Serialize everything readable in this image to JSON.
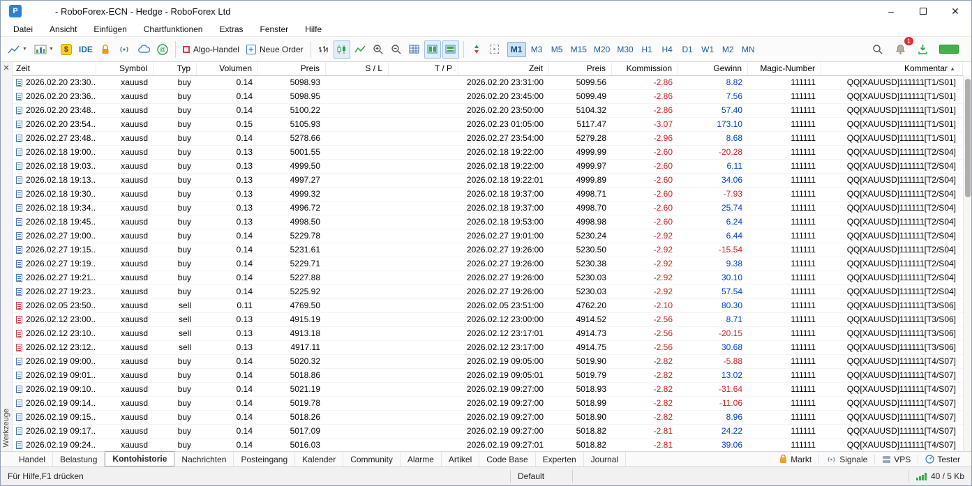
{
  "window": {
    "title": "- RoboForex-ECN - Hedge - RoboForex Ltd",
    "app_icon_text": "P"
  },
  "menu": {
    "items": [
      "Datei",
      "Ansicht",
      "Einfügen",
      "Chartfunktionen",
      "Extras",
      "Fenster",
      "Hilfe"
    ]
  },
  "toolbar": {
    "ide_label": "IDE",
    "algo_trading_label": "Algo-Handel",
    "new_order_label": "Neue Order",
    "dollar_symbol": "$",
    "plus_symbol": "+",
    "timeframes": [
      "M1",
      "M3",
      "M5",
      "M15",
      "M20",
      "M30",
      "H1",
      "H4",
      "D1",
      "W1",
      "M2",
      "MN"
    ],
    "active_timeframe": "M1",
    "notification_badge": "1"
  },
  "toolbox": {
    "vertical_label": "Werkzeuge",
    "close_glyph": "✕"
  },
  "history_table": {
    "headers": [
      "Zeit",
      "Symbol",
      "Typ",
      "Volumen",
      "Preis",
      "S / L",
      "T / P",
      "Zeit",
      "Preis",
      "Kommission",
      "Gewinn",
      "Magic-Number",
      "Kommentar"
    ],
    "sorted_by": "Kommentar",
    "sort_direction": "ascending",
    "rows": [
      [
        "2026.02.20 23:30...",
        "xauusd",
        "buy",
        "0.14",
        "5098.93",
        "",
        "",
        "2026.02.20 23:31:00",
        "5099.56",
        "-2.86",
        "8.82",
        "111111",
        "QQ[XAUUSD]111111[T1/S01]"
      ],
      [
        "2026.02.20 23:36...",
        "xauusd",
        "buy",
        "0.14",
        "5098.95",
        "",
        "",
        "2026.02.20 23:45:00",
        "5099.49",
        "-2.86",
        "7.56",
        "111111",
        "QQ[XAUUSD]111111[T1/S01]"
      ],
      [
        "2026.02.20 23:48...",
        "xauusd",
        "buy",
        "0.14",
        "5100.22",
        "",
        "",
        "2026.02.20 23:50:00",
        "5104.32",
        "-2.86",
        "57.40",
        "111111",
        "QQ[XAUUSD]111111[T1/S01]"
      ],
      [
        "2026.02.20 23:54...",
        "xauusd",
        "buy",
        "0.15",
        "5105.93",
        "",
        "",
        "2026.02.23 01:05:00",
        "5117.47",
        "-3.07",
        "173.10",
        "111111",
        "QQ[XAUUSD]111111[T1/S01]"
      ],
      [
        "2026.02.27 23:48...",
        "xauusd",
        "buy",
        "0.14",
        "5278.66",
        "",
        "",
        "2026.02.27 23:54:00",
        "5279.28",
        "-2.96",
        "8.68",
        "111111",
        "QQ[XAUUSD]111111[T1/S01]"
      ],
      [
        "2026.02.18 19:00...",
        "xauusd",
        "buy",
        "0.13",
        "5001.55",
        "",
        "",
        "2026.02.18 19:22:00",
        "4999.99",
        "-2.60",
        "-20.28",
        "111111",
        "QQ[XAUUSD]111111[T2/S04]"
      ],
      [
        "2026.02.18 19:03...",
        "xauusd",
        "buy",
        "0.13",
        "4999.50",
        "",
        "",
        "2026.02.18 19:22:00",
        "4999.97",
        "-2.60",
        "6.11",
        "111111",
        "QQ[XAUUSD]111111[T2/S04]"
      ],
      [
        "2026.02.18 19:13...",
        "xauusd",
        "buy",
        "0.13",
        "4997.27",
        "",
        "",
        "2026.02.18 19:22:01",
        "4999.89",
        "-2.60",
        "34.06",
        "111111",
        "QQ[XAUUSD]111111[T2/S04]"
      ],
      [
        "2026.02.18 19:30...",
        "xauusd",
        "buy",
        "0.13",
        "4999.32",
        "",
        "",
        "2026.02.18 19:37:00",
        "4998.71",
        "-2.60",
        "-7.93",
        "111111",
        "QQ[XAUUSD]111111[T2/S04]"
      ],
      [
        "2026.02.18 19:34...",
        "xauusd",
        "buy",
        "0.13",
        "4996.72",
        "",
        "",
        "2026.02.18 19:37:00",
        "4998.70",
        "-2.60",
        "25.74",
        "111111",
        "QQ[XAUUSD]111111[T2/S04]"
      ],
      [
        "2026.02.18 19:45...",
        "xauusd",
        "buy",
        "0.13",
        "4998.50",
        "",
        "",
        "2026.02.18 19:53:00",
        "4998.98",
        "-2.60",
        "6.24",
        "111111",
        "QQ[XAUUSD]111111[T2/S04]"
      ],
      [
        "2026.02.27 19:00...",
        "xauusd",
        "buy",
        "0.14",
        "5229.78",
        "",
        "",
        "2026.02.27 19:01:00",
        "5230.24",
        "-2.92",
        "6.44",
        "111111",
        "QQ[XAUUSD]111111[T2/S04]"
      ],
      [
        "2026.02.27 19:15...",
        "xauusd",
        "buy",
        "0.14",
        "5231.61",
        "",
        "",
        "2026.02.27 19:26:00",
        "5230.50",
        "-2.92",
        "-15.54",
        "111111",
        "QQ[XAUUSD]111111[T2/S04]"
      ],
      [
        "2026.02.27 19:19...",
        "xauusd",
        "buy",
        "0.14",
        "5229.71",
        "",
        "",
        "2026.02.27 19:26:00",
        "5230.38",
        "-2.92",
        "9.38",
        "111111",
        "QQ[XAUUSD]111111[T2/S04]"
      ],
      [
        "2026.02.27 19:21...",
        "xauusd",
        "buy",
        "0.14",
        "5227.88",
        "",
        "",
        "2026.02.27 19:26:00",
        "5230.03",
        "-2.92",
        "30.10",
        "111111",
        "QQ[XAUUSD]111111[T2/S04]"
      ],
      [
        "2026.02.27 19:23...",
        "xauusd",
        "buy",
        "0.14",
        "5225.92",
        "",
        "",
        "2026.02.27 19:26:00",
        "5230.03",
        "-2.92",
        "57.54",
        "111111",
        "QQ[XAUUSD]111111[T2/S04]"
      ],
      [
        "2026.02.05 23:50...",
        "xauusd",
        "sell",
        "0.11",
        "4769.50",
        "",
        "",
        "2026.02.05 23:51:00",
        "4762.20",
        "-2.10",
        "80.30",
        "111111",
        "QQ[XAUUSD]111111[T3/S06]"
      ],
      [
        "2026.02.12 23:00...",
        "xauusd",
        "sell",
        "0.13",
        "4915.19",
        "",
        "",
        "2026.02.12 23:00:00",
        "4914.52",
        "-2.56",
        "8.71",
        "111111",
        "QQ[XAUUSD]111111[T3/S06]"
      ],
      [
        "2026.02.12 23:10...",
        "xauusd",
        "sell",
        "0.13",
        "4913.18",
        "",
        "",
        "2026.02.12 23:17:01",
        "4914.73",
        "-2.56",
        "-20.15",
        "111111",
        "QQ[XAUUSD]111111[T3/S06]"
      ],
      [
        "2026.02.12 23:12...",
        "xauusd",
        "sell",
        "0.13",
        "4917.11",
        "",
        "",
        "2026.02.12 23:17:00",
        "4914.75",
        "-2.56",
        "30.68",
        "111111",
        "QQ[XAUUSD]111111[T3/S06]"
      ],
      [
        "2026.02.19 09:00...",
        "xauusd",
        "buy",
        "0.14",
        "5020.32",
        "",
        "",
        "2026.02.19 09:05:00",
        "5019.90",
        "-2.82",
        "-5.88",
        "111111",
        "QQ[XAUUSD]111111[T4/S07]"
      ],
      [
        "2026.02.19 09:01...",
        "xauusd",
        "buy",
        "0.14",
        "5018.86",
        "",
        "",
        "2026.02.19 09:05:01",
        "5019.79",
        "-2.82",
        "13.02",
        "111111",
        "QQ[XAUUSD]111111[T4/S07]"
      ],
      [
        "2026.02.19 09:10...",
        "xauusd",
        "buy",
        "0.14",
        "5021.19",
        "",
        "",
        "2026.02.19 09:27:00",
        "5018.93",
        "-2.82",
        "-31.64",
        "111111",
        "QQ[XAUUSD]111111[T4/S07]"
      ],
      [
        "2026.02.19 09:14...",
        "xauusd",
        "buy",
        "0.14",
        "5019.78",
        "",
        "",
        "2026.02.19 09:27:00",
        "5018.99",
        "-2.82",
        "-11.06",
        "111111",
        "QQ[XAUUSD]111111[T4/S07]"
      ],
      [
        "2026.02.19 09:15...",
        "xauusd",
        "buy",
        "0.14",
        "5018.26",
        "",
        "",
        "2026.02.19 09:27:00",
        "5018.90",
        "-2.82",
        "8.96",
        "111111",
        "QQ[XAUUSD]111111[T4/S07]"
      ],
      [
        "2026.02.19 09:17...",
        "xauusd",
        "buy",
        "0.14",
        "5017.09",
        "",
        "",
        "2026.02.19 09:27:00",
        "5018.82",
        "-2.81",
        "24.22",
        "111111",
        "QQ[XAUUSD]111111[T4/S07]"
      ],
      [
        "2026.02.19 09:24...",
        "xauusd",
        "buy",
        "0.14",
        "5016.03",
        "",
        "",
        "2026.02.19 09:27:01",
        "5018.82",
        "-2.81",
        "39.06",
        "111111",
        "QQ[XAUUSD]111111[T4/S07]"
      ]
    ]
  },
  "bottom_tabs": {
    "items": [
      "Handel",
      "Belastung",
      "Kontohistorie",
      "Nachrichten",
      "Posteingang",
      "Kalender",
      "Community",
      "Alarme",
      "Artikel",
      "Code Base",
      "Experten",
      "Journal"
    ],
    "active": "Kontohistorie",
    "right": {
      "market": "Markt",
      "signals": "Signale",
      "vps": "VPS",
      "tester": "Tester"
    }
  },
  "statusbar": {
    "help_text": "Für Hilfe,F1 drücken",
    "profile": "Default",
    "traffic": "40 / 5 Kb"
  },
  "colors": {
    "profit": "#0040c8",
    "loss": "#d02020",
    "buy_icon": "#4a7ab5",
    "sell_icon": "#cc4444",
    "active_timeframe_bg": "#cfe3f7"
  }
}
